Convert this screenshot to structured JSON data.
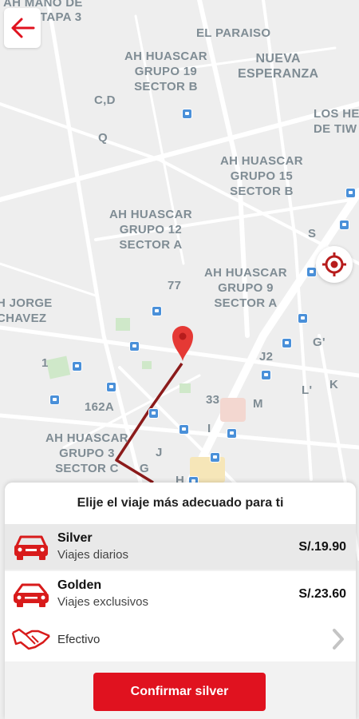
{
  "map": {
    "labels": [
      {
        "text": "AH MANO DE",
        "name": "map-label-ah-mano-de"
      },
      {
        "text": "TAPA 3",
        "name": "map-label-tapa-3"
      },
      {
        "text": "EL PARAISO",
        "name": "map-label-el-paraiso"
      },
      {
        "text": "AH HUASCAR\nGRUPO 19\nSECTOR B",
        "name": "map-label-huascar-19"
      },
      {
        "text": "NUEVA\nESPERANZA",
        "name": "map-label-nueva-esperanza"
      },
      {
        "text": "C,D",
        "name": "map-label-cd"
      },
      {
        "text": "LOS HE\nDE TIW",
        "name": "map-label-los-he"
      },
      {
        "text": "Q",
        "name": "map-label-q"
      },
      {
        "text": "AH HUASCAR\nGRUPO 15\nSECTOR B",
        "name": "map-label-huascar-15"
      },
      {
        "text": "AH HUASCAR\nGRUPO 12\nSECTOR A",
        "name": "map-label-huascar-12"
      },
      {
        "text": "S",
        "name": "map-label-s"
      },
      {
        "text": "AH HUASCAR\nGRUPO 9\nSECTOR A",
        "name": "map-label-huascar-9"
      },
      {
        "text": "77",
        "name": "map-label-77"
      },
      {
        "text": "H JORGE\nCHAVEZ",
        "name": "map-label-jorge-chavez"
      },
      {
        "text": "G'",
        "name": "map-label-g-prime"
      },
      {
        "text": "J2",
        "name": "map-label-j2"
      },
      {
        "text": "1",
        "name": "map-label-1"
      },
      {
        "text": "L'",
        "name": "map-label-l-prime"
      },
      {
        "text": "K",
        "name": "map-label-k"
      },
      {
        "text": "33",
        "name": "map-label-33"
      },
      {
        "text": "M",
        "name": "map-label-m"
      },
      {
        "text": "162A",
        "name": "map-label-162a"
      },
      {
        "text": "I",
        "name": "map-label-i"
      },
      {
        "text": "AH HUASCAR\nGRUPO 3\nSECTOR C",
        "name": "map-label-huascar-3"
      },
      {
        "text": "J",
        "name": "map-label-j"
      },
      {
        "text": "G",
        "name": "map-label-g"
      },
      {
        "text": "H",
        "name": "map-label-h"
      }
    ]
  },
  "colors": {
    "accent": "#e0121f",
    "route": "#8b1a1a",
    "bus_stop": "#4a90d9",
    "map_label": "#7f8c94"
  },
  "icons": {
    "back": "arrow-left-icon",
    "locate": "crosshair-icon",
    "pin": "map-pin-icon",
    "car": "car-icon",
    "payment": "handshake-icon",
    "chevron": "chevron-right-icon"
  },
  "sheet": {
    "title": "Elije el viaje más adecuado para ti",
    "options": [
      {
        "name": "Silver",
        "subtitle": "Viajes diarios",
        "price": "S/.19.90",
        "selected": true
      },
      {
        "name": "Golden",
        "subtitle": "Viajes exclusivos",
        "price": "S/.23.60",
        "selected": false
      }
    ],
    "payment_label": "Efectivo",
    "confirm_label": "Confirmar silver"
  }
}
